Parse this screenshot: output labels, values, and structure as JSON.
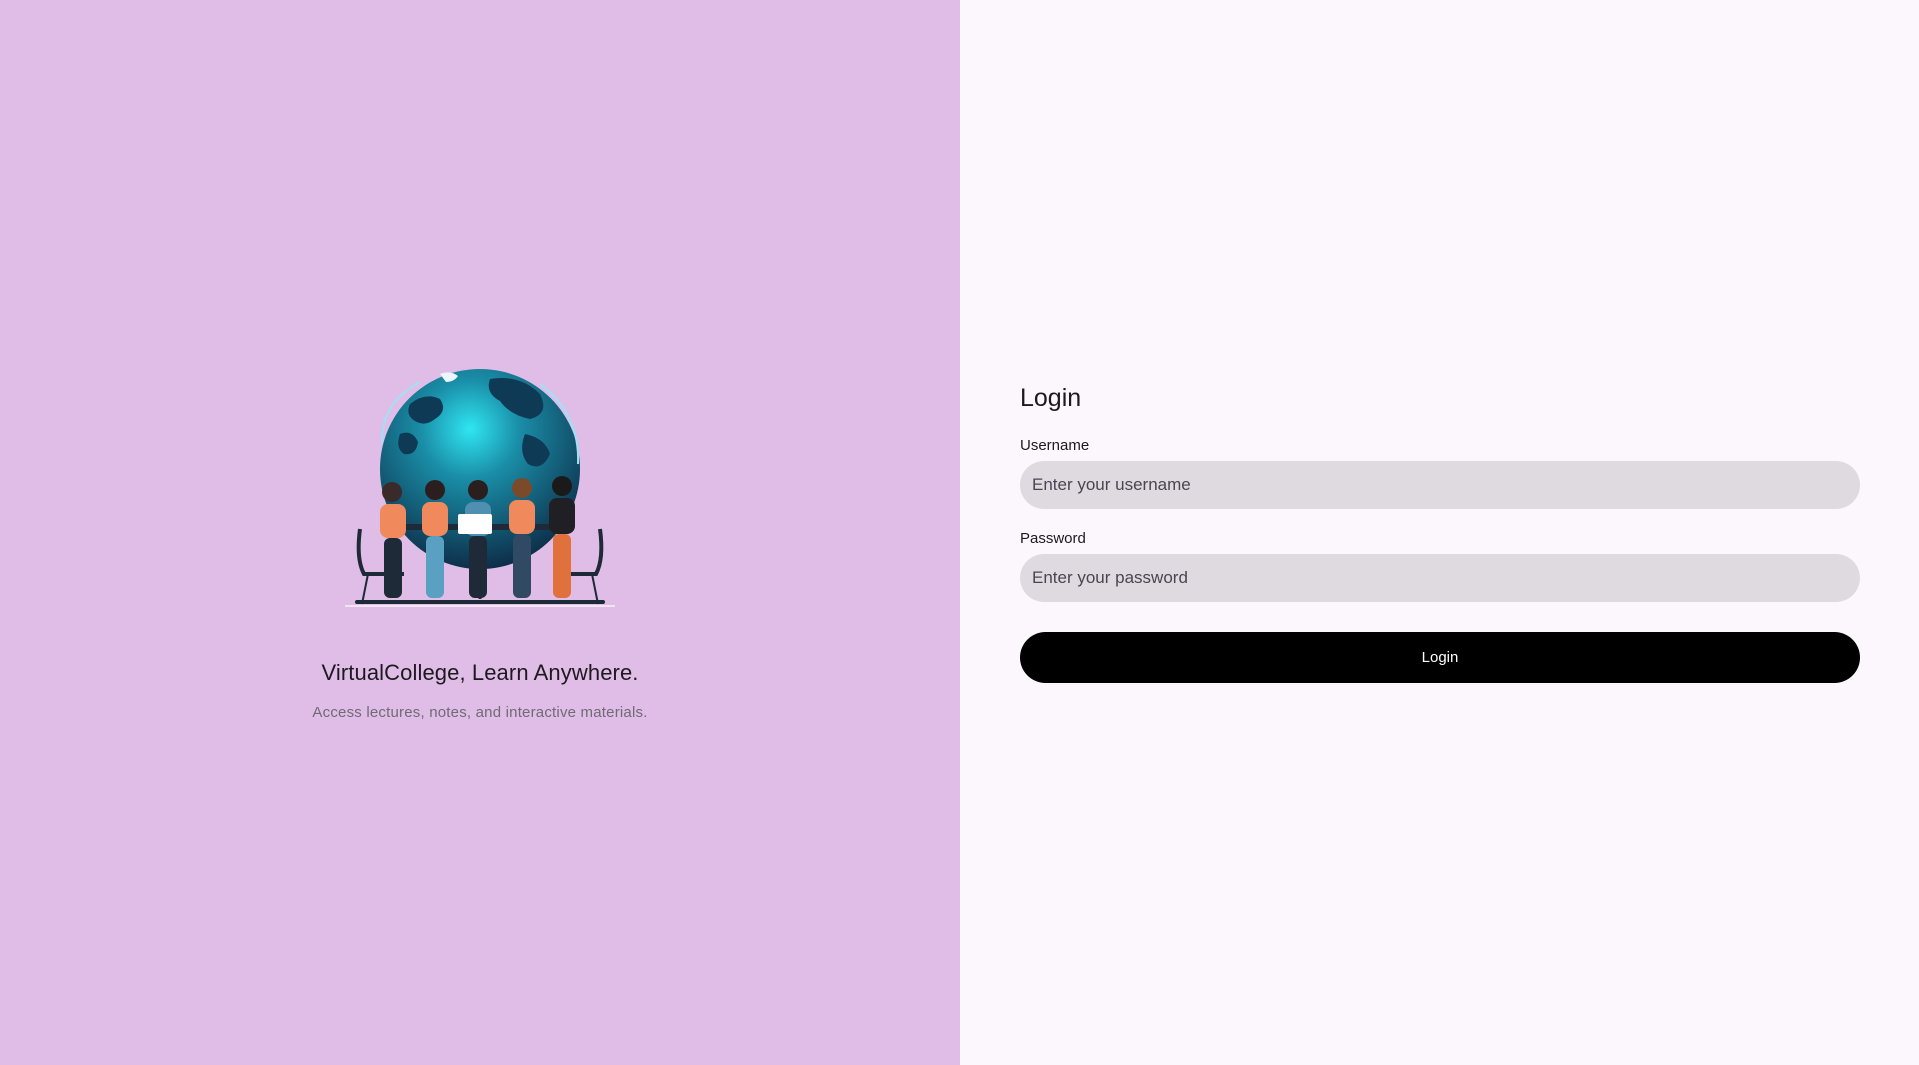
{
  "brand": {
    "title": "VirtualCollege, Learn Anywhere.",
    "subtitle": "Access lectures, notes, and interactive materials.",
    "panel_color": "#e0bde6"
  },
  "login": {
    "title": "Login",
    "username_label": "Username",
    "username_placeholder": "Enter your username",
    "username_value": "",
    "password_label": "Password",
    "password_placeholder": "Enter your password",
    "password_value": "",
    "submit_label": "Login"
  },
  "illustration": {
    "icon": "students-around-globe-illustration"
  }
}
